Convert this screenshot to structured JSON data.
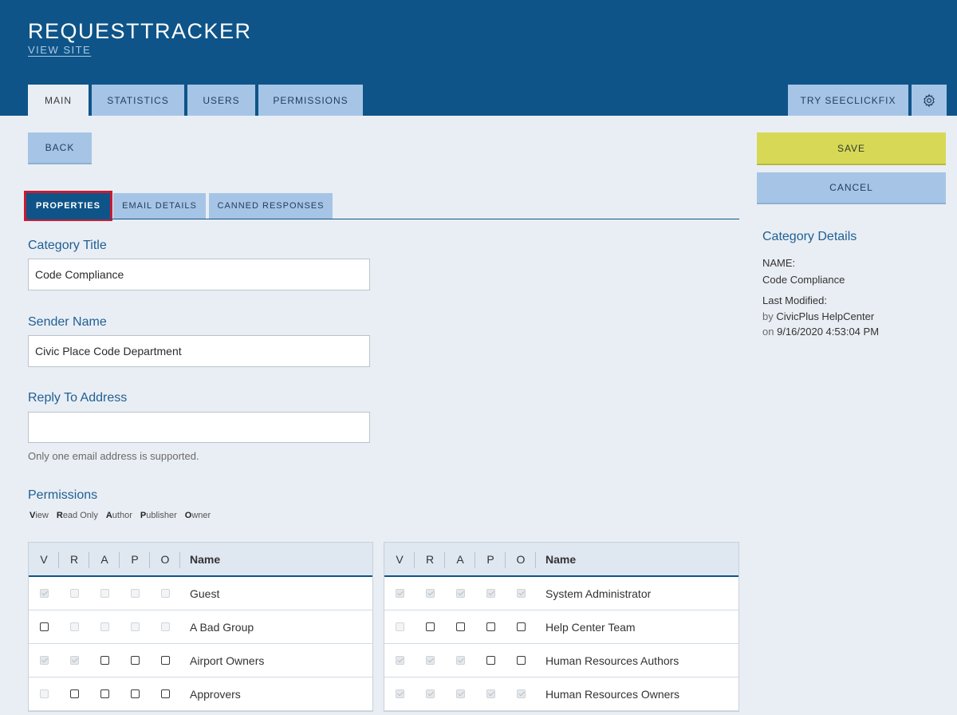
{
  "header": {
    "app_title": "REQUESTTRACKER",
    "view_site": "VIEW SITE",
    "tabs": [
      {
        "label": "MAIN"
      },
      {
        "label": "STATISTICS"
      },
      {
        "label": "USERS"
      },
      {
        "label": "PERMISSIONS"
      }
    ],
    "try_button": "TRY SEECLICKFIX",
    "settings_icon": "gear-icon"
  },
  "actions": {
    "back": "BACK",
    "save": "SAVE",
    "cancel": "CANCEL"
  },
  "sub_tabs": [
    {
      "label": "PROPERTIES"
    },
    {
      "label": "EMAIL DETAILS"
    },
    {
      "label": "CANNED RESPONSES"
    }
  ],
  "form": {
    "category_title": {
      "label": "Category Title",
      "value": "Code Compliance"
    },
    "sender_name": {
      "label": "Sender Name",
      "value": "Civic Place Code Department"
    },
    "reply_to": {
      "label": "Reply To Address",
      "value": "",
      "help": "Only one email address is supported."
    }
  },
  "permissions": {
    "heading": "Permissions",
    "legend": [
      {
        "key": "V",
        "rest": "iew"
      },
      {
        "key": "R",
        "rest": "ead Only"
      },
      {
        "key": "A",
        "rest": "uthor"
      },
      {
        "key": "P",
        "rest": "ublisher"
      },
      {
        "key": "O",
        "rest": "wner"
      }
    ],
    "columns": [
      "V",
      "R",
      "A",
      "P",
      "O",
      "Name"
    ],
    "left_table": [
      {
        "name": "Guest",
        "states": [
          "chk",
          "dis",
          "dis",
          "dis",
          "dis"
        ]
      },
      {
        "name": "A Bad Group",
        "states": [
          "on",
          "dis",
          "dis",
          "dis",
          "dis"
        ]
      },
      {
        "name": "Airport Owners",
        "states": [
          "chk",
          "chk",
          "on",
          "on",
          "on"
        ]
      },
      {
        "name": "Approvers",
        "states": [
          "dis",
          "on",
          "on",
          "on",
          "on"
        ]
      }
    ],
    "right_table": [
      {
        "name": "System Administrator",
        "states": [
          "chk",
          "chk",
          "chk",
          "chk",
          "chk"
        ]
      },
      {
        "name": "Help Center Team",
        "states": [
          "dis",
          "on",
          "on",
          "on",
          "on"
        ]
      },
      {
        "name": "Human Resources Authors",
        "states": [
          "chk",
          "chk",
          "chk",
          "on",
          "on"
        ]
      },
      {
        "name": "Human Resources Owners",
        "states": [
          "chk",
          "chk",
          "chk",
          "chk",
          "chk"
        ]
      }
    ]
  },
  "details": {
    "title": "Category Details",
    "name_label": "NAME:",
    "name_value": "Code Compliance",
    "modified_label": "Last Modified:",
    "by_prefix": "by",
    "by_value": "CivicPlus HelpCenter",
    "on_prefix": "on",
    "on_value": "9/16/2020 4:53:04 PM"
  },
  "colors": {
    "header_bg": "#0e5488",
    "tab_bg": "#a6c5e6",
    "save_bg": "#d7d856",
    "active_outline": "#c81b33"
  }
}
